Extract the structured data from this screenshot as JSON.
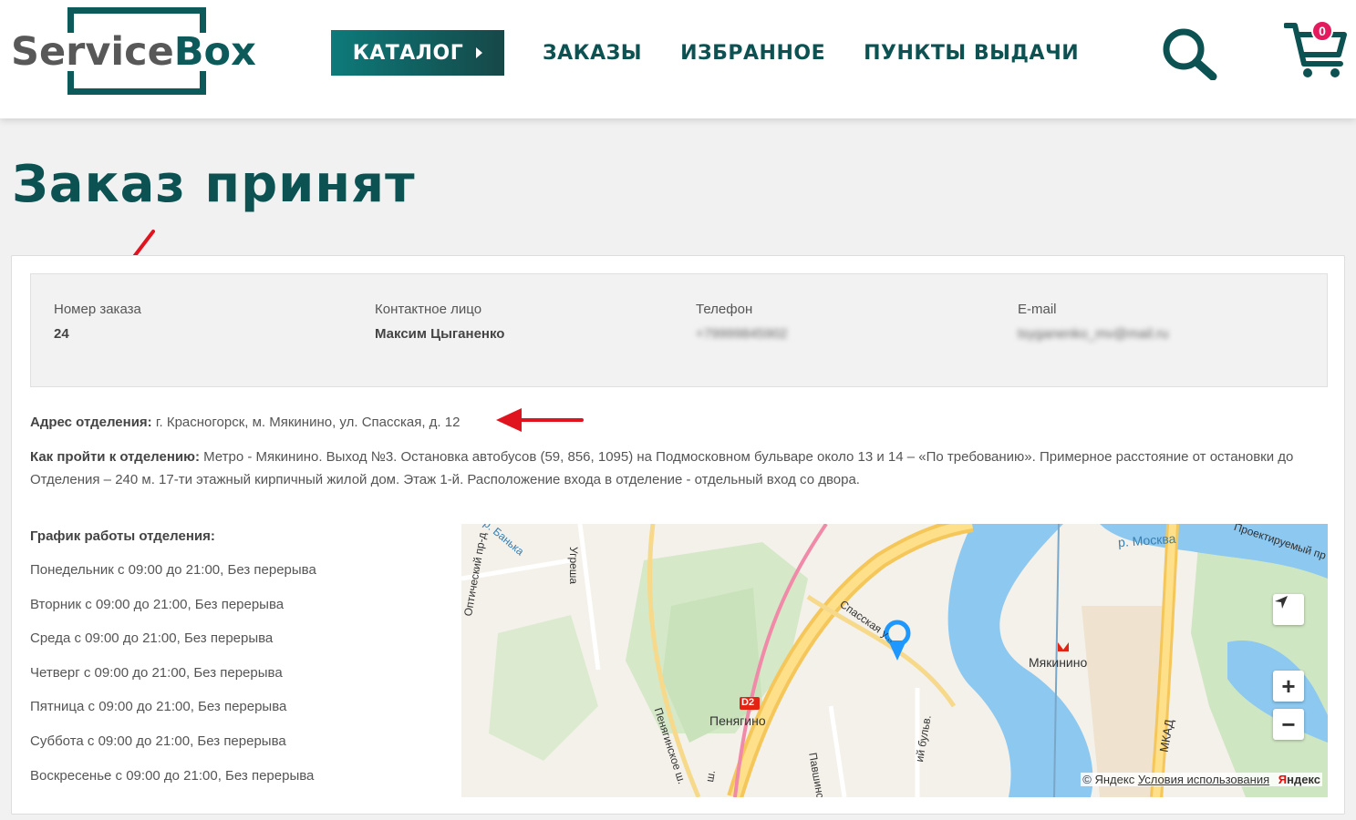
{
  "brand": {
    "logo_part1": "Service",
    "logo_part2": "Box"
  },
  "nav": {
    "catalog": "КАТАЛОГ",
    "orders": "ЗАКАЗЫ",
    "favorites": "ИЗБРАННОЕ",
    "pickup_points": "ПУНКТЫ ВЫДАЧИ"
  },
  "cart": {
    "count": "0"
  },
  "page": {
    "title": "Заказ принят"
  },
  "order": {
    "number_label": "Номер заказа",
    "number": "24",
    "contact_label": "Контактное лицо",
    "contact": "Максим Цыганенко",
    "phone_label": "Телефон",
    "phone": "+79999845902",
    "email_label": "E-mail",
    "email": "tsyganenko_mv@mail.ru"
  },
  "branch": {
    "address_label": "Адрес отделения:",
    "address": " г. Красногорск, м. Мякинино, ул. Спасская, д. 12",
    "how_label": "Как пройти к отделению:",
    "how": " Метро - Мякинино. Выход №3. Остановка автобусов (59, 856, 1095) на Подмосковном бульваре около 13 и 14 – «По требованию». Примерное расстояние от остановки до Отделения – 240 м. 17-ти этажный кирпичный жилой дом. Этаж 1-й. Расположение входа в отделение - отдельный вход со двора."
  },
  "schedule": {
    "title": "График работы отделения:",
    "days": [
      "Понедельник с 09:00 до 21:00, Без перерыва",
      "Вторник с 09:00 до 21:00, Без перерыва",
      "Среда с 09:00 до 21:00, Без перерыва",
      "Четверг с 09:00 до 21:00, Без перерыва",
      "Пятница с 09:00 до 21:00, Без перерыва",
      "Суббота с 09:00 до 21:00, Без перерыва",
      "Воскресенье с 09:00 до 21:00, Без перерыва"
    ]
  },
  "map": {
    "labels": {
      "river": "р. Москва",
      "banka": "р. Банька",
      "projected": "Проектируемый пр",
      "optical": "Оптический пр-д",
      "spasskaya": "Спасская у...",
      "myakinino": "Мякинино",
      "penyagino_station": "Пенягино",
      "penyaginskoe": "Пенягинское ш.",
      "pavshinsky": "Павшинский бул.",
      "mkad": "МКАД",
      "d2": "D2",
      "ugreshka": "Угреша",
      "bulv": "ий бульв.",
      "sh": "ш."
    },
    "copyright": "© Яндекс",
    "terms": "Условия использования",
    "yandex_logo_red": "Я",
    "yandex_logo_rest": "ндекс",
    "zoom_in": "+",
    "zoom_out": "−"
  },
  "colors": {
    "brand": "#0d5a5a",
    "badge": "#e5195e",
    "arrow": "#e0141e"
  }
}
